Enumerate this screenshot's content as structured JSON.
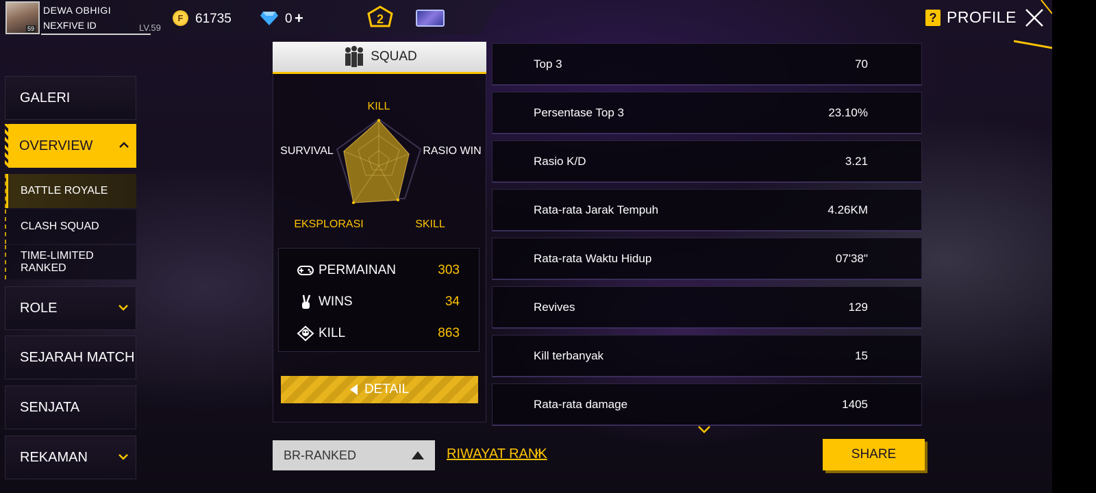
{
  "player": {
    "name": "DEWA    OBHIGI",
    "clan": "NEXFIVE ID",
    "level": "LV.59",
    "avatar_level": "59"
  },
  "currency": {
    "coins": "61735",
    "diamonds": "0",
    "diamond_add": "+"
  },
  "header": {
    "title": "PROFILE",
    "help": "?"
  },
  "sidebar": {
    "items": [
      {
        "label": "GALERI"
      },
      {
        "label": "OVERVIEW"
      },
      {
        "label": "ROLE"
      },
      {
        "label": "SEJARAH MATCH"
      },
      {
        "label": "SENJATA"
      },
      {
        "label": "REKAMAN"
      }
    ],
    "subitems": [
      {
        "label": "BATTLE ROYALE"
      },
      {
        "label": "CLASH SQUAD"
      },
      {
        "label": "TIME-LIMITED RANKED"
      }
    ]
  },
  "squad_tab": {
    "label": "SQUAD"
  },
  "radar": {
    "labels": {
      "kill": "KILL",
      "rasio_win": "RASIO WIN",
      "skill": "SKILL",
      "eksplorasi": "EKSPLORASI",
      "survival": "SURVIVAL"
    }
  },
  "summary": [
    {
      "label": "PERMAINAN",
      "value": "303"
    },
    {
      "label": "WINS",
      "value": "34"
    },
    {
      "label": "KILL",
      "value": "863"
    }
  ],
  "detail_button": {
    "label": "DETAIL"
  },
  "stats": [
    {
      "label": "Top 3",
      "value": "70"
    },
    {
      "label": "Persentase Top 3",
      "value": "23.10%"
    },
    {
      "label": "Rasio K/D",
      "value": "3.21"
    },
    {
      "label": "Rata-rata Jarak Tempuh",
      "value": "4.26KM"
    },
    {
      "label": "Rata-rata Waktu Hidup",
      "value": "07'38\""
    },
    {
      "label": "Revives",
      "value": "129"
    },
    {
      "label": "Kill terbanyak",
      "value": "15"
    },
    {
      "label": "Rata-rata damage",
      "value": "1405"
    }
  ],
  "bottom": {
    "mode": "BR-RANKED",
    "rank_history": "RIWAYAT RANK",
    "rank_history_arrow": "»",
    "share": "SHARE"
  },
  "colors": {
    "accent": "#ffc400",
    "panel": "#0f0a16",
    "background": "#1a1126"
  }
}
